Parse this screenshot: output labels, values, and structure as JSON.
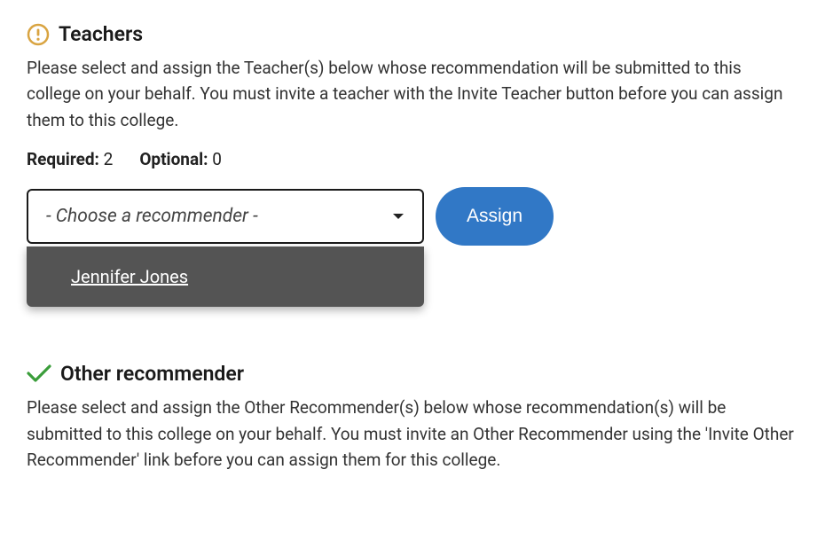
{
  "teachers": {
    "title": "Teachers",
    "description": "Please select and assign the Teacher(s) below whose recommendation will be submitted to this college on your behalf. You must invite a teacher with the Invite Teacher button before you can assign them to this college.",
    "required_label": "Required:",
    "required_value": "2",
    "optional_label": "Optional:",
    "optional_value": "0",
    "dropdown_placeholder": "- Choose a recommender -",
    "dropdown_options": [
      "Jennifer Jones"
    ],
    "assign_label": "Assign"
  },
  "other": {
    "title": "Other recommender",
    "description": "Please select and assign the Other Recommender(s) below whose recommendation(s) will be submitted to this college on your behalf. You must invite an Other Recommender using the 'Invite Other Recommender' link before you can assign them for this college."
  }
}
